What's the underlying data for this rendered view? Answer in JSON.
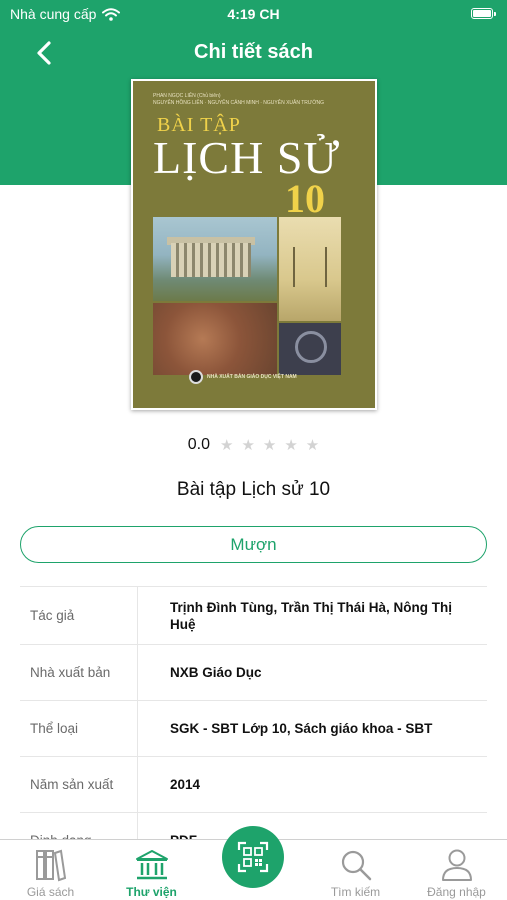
{
  "status_bar": {
    "carrier": "Nhà cung cấp",
    "time": "4:19 CH"
  },
  "header": {
    "title": "Chi tiết sách",
    "back_icon": "chevron-left-icon"
  },
  "book": {
    "cover": {
      "credits_line1": "PHAN NGỌC LIÊN (Chủ biên)",
      "credits_line2": "NGUYỄN HỒNG LIÊN · NGUYỄN CẢNH MINH · NGUYỄN XUÂN TRƯỜNG",
      "subtitle": "BÀI TẬP",
      "title": "LỊCH SỬ",
      "grade": "10",
      "publisher": "NHÀ XUẤT BẢN GIÁO DỤC VIỆT NAM"
    },
    "rating": "0.0",
    "rating_stars": 0,
    "rating_max": 5,
    "title": "Bài tập Lịch sử 10",
    "borrow_label": "Mượn"
  },
  "details": [
    {
      "label": "Tác giả",
      "value": "Trịnh Đình Tùng, Trần Thị Thái Hà, Nông Thị Huệ"
    },
    {
      "label": "Nhà xuất bản",
      "value": "NXB Giáo Dục"
    },
    {
      "label": "Thể loại",
      "value": "SGK - SBT  Lớp 10, Sách giáo khoa - SBT"
    },
    {
      "label": "Năm sản xuất",
      "value": "2014"
    },
    {
      "label": "Định dạng",
      "value": "PDF"
    }
  ],
  "tabs": [
    {
      "label": "Giá sách",
      "icon": "bookshelf-icon",
      "active": false
    },
    {
      "label": "Thư viện",
      "icon": "library-icon",
      "active": true
    },
    {
      "label": "Tìm kiếm",
      "icon": "search-icon",
      "active": false
    },
    {
      "label": "Đăng nhập",
      "icon": "user-icon",
      "active": false
    }
  ],
  "scan_button": {
    "icon": "qr-scan-icon"
  },
  "colors": {
    "brand": "#1ea36b",
    "inactive_tab": "#9a9a9a",
    "star_empty": "#d3d3d3"
  }
}
